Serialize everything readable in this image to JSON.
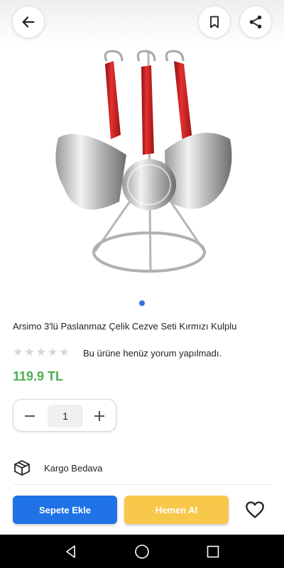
{
  "header": {
    "back_icon": "arrow-left-icon",
    "bookmark_icon": "bookmark-icon",
    "share_icon": "share-icon"
  },
  "product": {
    "title": "Arsimo 3'lü Paslanmaz Çelik Cezve Seti Kırmızı Kulplu",
    "rating_stars": 0,
    "rating_max": 5,
    "review_text": "Bu ürüne henüz yorum yapılmadı.",
    "price": "119.9 TL",
    "image_count": 1,
    "active_image": 1
  },
  "quantity": {
    "value": "1",
    "minus_icon": "minus-icon",
    "plus_icon": "plus-icon"
  },
  "shipping": {
    "icon": "package-box-icon",
    "label": "Kargo Bedava"
  },
  "actions": {
    "add_to_cart": "Sepete Ekle",
    "buy_now": "Hemen Al",
    "favorite_icon": "heart-icon"
  },
  "colors": {
    "price_green": "#4caf50",
    "primary_blue": "#1f73e6",
    "buy_yellow": "#f7c84a",
    "pager_active": "#2f74e0"
  },
  "system_nav": {
    "back_icon": "triangle-back-icon",
    "home_icon": "circle-home-icon",
    "recents_icon": "square-recents-icon"
  }
}
